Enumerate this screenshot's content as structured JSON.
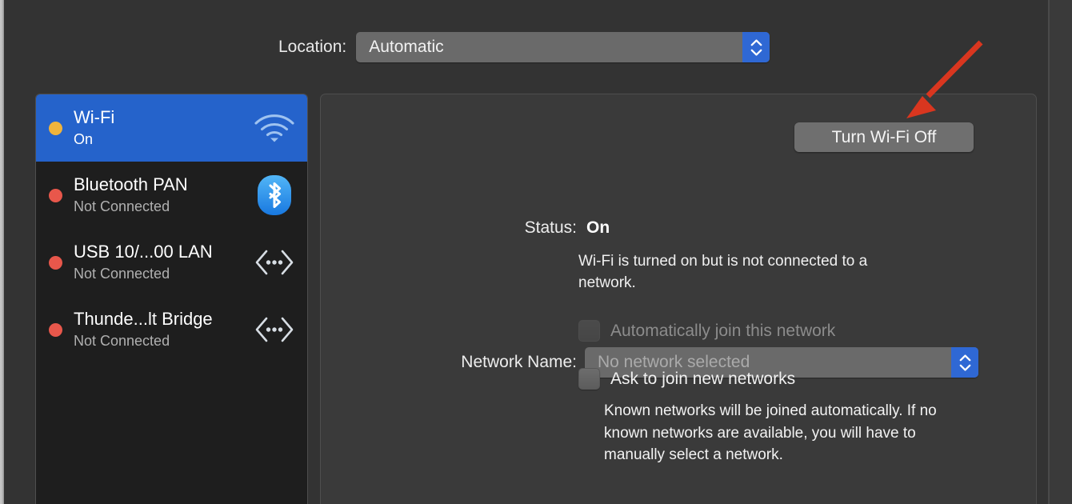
{
  "window": {
    "background_color": "#333333",
    "panel_color": "#3a3a3a",
    "sidebar_color": "#1e1e1e",
    "accent_color": "#2f68d4",
    "selection_color": "#2563cb"
  },
  "location": {
    "label": "Location:",
    "value": "Automatic",
    "stepper_icon": "chevron-up-down-icon"
  },
  "sidebar": {
    "items": [
      {
        "name": "Wi-Fi",
        "status": "On",
        "dot_color": "#f0b43c",
        "dot_state": "orange",
        "icon": "wifi-icon",
        "selected": true
      },
      {
        "name": "Bluetooth PAN",
        "status": "Not Connected",
        "dot_color": "#e8574b",
        "dot_state": "red",
        "icon": "bluetooth-icon",
        "selected": false
      },
      {
        "name": "USB 10/...00 LAN",
        "status": "Not Connected",
        "dot_color": "#e8574b",
        "dot_state": "red",
        "icon": "ethernet-icon",
        "selected": false
      },
      {
        "name": "Thunde...lt Bridge",
        "status": "Not Connected",
        "dot_color": "#e8574b",
        "dot_state": "red",
        "icon": "ethernet-icon",
        "selected": false
      }
    ]
  },
  "detail": {
    "status_label": "Status:",
    "status_value": "On",
    "toggle_button": "Turn Wi-Fi Off",
    "status_description": "Wi-Fi is turned on but is not connected to a network.",
    "network_name_label": "Network Name:",
    "network_name_value": "No network selected",
    "network_name_stepper_icon": "chevron-up-down-icon",
    "checkbox_auto_join": {
      "label": "Automatically join this network",
      "checked": false,
      "disabled": true
    },
    "checkbox_ask_join": {
      "label": "Ask to join new networks",
      "checked": false,
      "disabled": false
    },
    "help_text": "Known networks will be joined automatically. If no known networks are available, you will have to manually select a network."
  },
  "annotation": {
    "arrow_color": "#d9361f",
    "arrow_name": "red-arrow-pointing-to-turn-wifi-off-button"
  }
}
